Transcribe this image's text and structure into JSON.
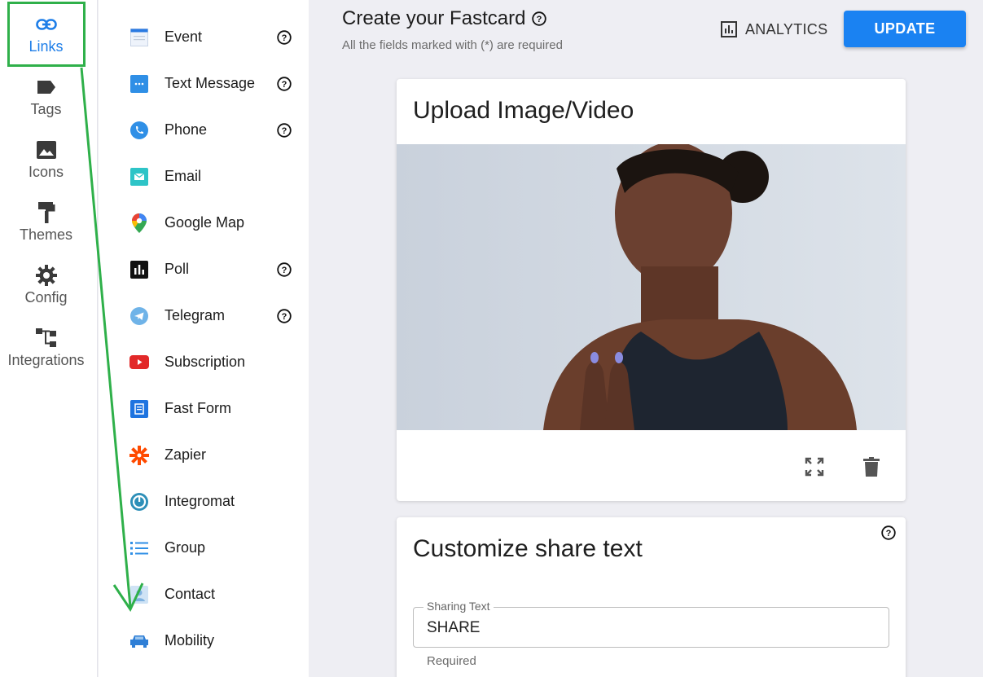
{
  "rail": {
    "items": [
      {
        "label": "Links",
        "icon": "link-icon"
      },
      {
        "label": "Tags",
        "icon": "tag-icon"
      },
      {
        "label": "Icons",
        "icon": "image-icon"
      },
      {
        "label": "Themes",
        "icon": "paint-roller-icon"
      },
      {
        "label": "Config",
        "icon": "gear-icon"
      },
      {
        "label": "Integrations",
        "icon": "integrations-icon"
      }
    ],
    "active_color": "#1e7ee8"
  },
  "link_types": [
    {
      "label": "Event",
      "icon": "calendar-icon"
    },
    {
      "label": "Text Message",
      "icon": "message-icon"
    },
    {
      "label": "Phone",
      "icon": "phone-icon"
    },
    {
      "label": "Email",
      "icon": "email-icon"
    },
    {
      "label": "Google Map",
      "icon": "map-pin-icon"
    },
    {
      "label": "Poll",
      "icon": "poll-icon"
    },
    {
      "label": "Telegram",
      "icon": "telegram-icon"
    },
    {
      "label": "Subscription",
      "icon": "youtube-icon"
    },
    {
      "label": "Fast Form",
      "icon": "form-icon"
    },
    {
      "label": "Zapier",
      "icon": "zapier-icon"
    },
    {
      "label": "Integromat",
      "icon": "integromat-icon"
    },
    {
      "label": "Group",
      "icon": "list-icon"
    },
    {
      "label": "Contact",
      "icon": "contact-icon"
    },
    {
      "label": "Mobility",
      "icon": "car-icon"
    }
  ],
  "header": {
    "title": "Create your Fastcard",
    "subtitle": "All the fields marked with (*) are required",
    "analytics_label": "ANALYTICS",
    "update_label": "UPDATE"
  },
  "upload_card": {
    "title": "Upload Image/Video"
  },
  "share_card": {
    "title": "Customize share text",
    "field_label": "Sharing Text",
    "field_value": "SHARE",
    "field_helper": "Required"
  },
  "colors": {
    "primary": "#1a82f2",
    "annotation": "#2fb04a"
  }
}
